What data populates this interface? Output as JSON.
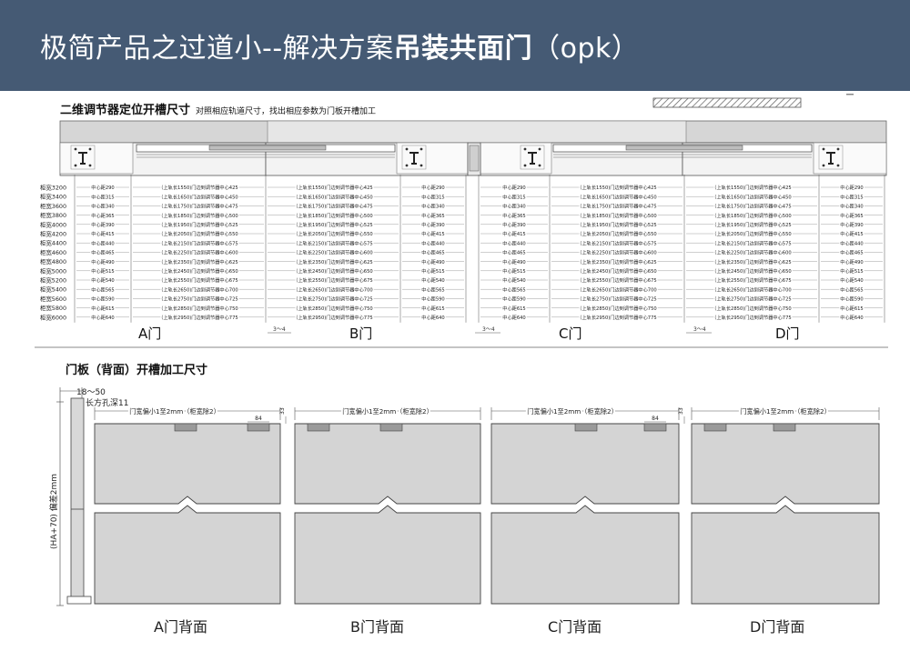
{
  "banner": {
    "title_prefix": "极简产品之过道小--解决方案",
    "title_bold": "吊装共面门",
    "title_suffix": "（opk）"
  },
  "section1": {
    "title": "二维调节器定位开槽尺寸",
    "note": "对照相应轨道尺寸，找出相应参数为门板开槽加工"
  },
  "table": {
    "cabinet_widths": [
      "柜宽3200",
      "柜宽3400",
      "柜宽3600",
      "柜宽3800",
      "柜宽4000",
      "柜宽4200",
      "柜宽4400",
      "柜宽4600",
      "柜宽4800",
      "柜宽5000",
      "柜宽5200",
      "柜宽5400",
      "柜宽5600",
      "柜宽5800",
      "柜宽6000"
    ],
    "center_distances": [
      "中心距290",
      "中心距315",
      "中心距340",
      "中心距365",
      "中心距390",
      "中心距415",
      "中心距440",
      "中心距465",
      "中心距490",
      "中心距515",
      "中心距540",
      "中心距565",
      "中心距590",
      "中心距615",
      "中心距640"
    ],
    "rail_specs": [
      "（上轨长1550)门边到调节器中心425",
      "（上轨长1650)门边到调节器中心450",
      "（上轨长1750)门边到调节器中心475",
      "（上轨长1850)门边到调节器中心500",
      "（上轨长1950)门边到调节器中心525",
      "（上轨长2050)门边到调节器中心550",
      "（上轨长2150)门边到调节器中心575",
      "（上轨长2250)门边到调节器中心600",
      "（上轨长2350)门边到调节器中心625",
      "（上轨长2450)门边到调节器中心650",
      "（上轨长2550)门边到调节器中心675",
      "（上轨长2650)门边到调节器中心700",
      "（上轨长2750)门边到调节器中心725",
      "（上轨长2850)门边到调节器中心750",
      "（上轨长2950)门边到调节器中心775"
    ],
    "gap_label": "3～4",
    "door_labels": [
      "A门",
      "B门",
      "C门",
      "D门"
    ]
  },
  "section2": {
    "title": "门板（背面）开槽加工尺寸"
  },
  "side_profile": {
    "range_label": "18～50",
    "hole_label": "长方孔深11",
    "height_label": "(HA+70) 偏差2mm"
  },
  "door_backs": {
    "width_label_a": "门宽偏小1至2mm（柜宽除2）",
    "width_label_b": "门宽偏小1至2mm（柜宽除2）",
    "slot_width_label": "84",
    "slot_depth_label": "33",
    "labels": [
      "A门背面",
      "B门背面",
      "C门背面",
      "D门背面"
    ]
  }
}
